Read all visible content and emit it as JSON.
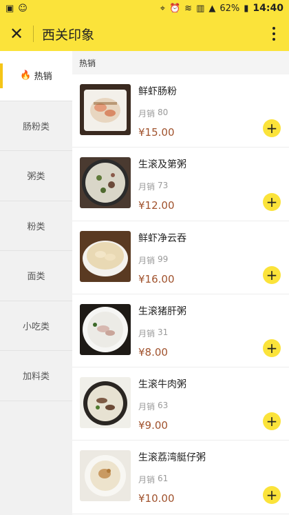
{
  "status_bar": {
    "left_icons": [
      "image-icon",
      "emoji-icon"
    ],
    "right_icons": [
      "location-icon",
      "alarm-icon",
      "wifi-icon",
      "hd-icon",
      "signal-icon"
    ],
    "battery": "62%",
    "time": "14:40"
  },
  "header": {
    "title": "西关印象"
  },
  "sidebar": {
    "items": [
      {
        "label": "热销",
        "active": true
      },
      {
        "label": "肠粉类"
      },
      {
        "label": "粥类"
      },
      {
        "label": "粉类"
      },
      {
        "label": "面类"
      },
      {
        "label": "小吃类"
      },
      {
        "label": "加料类"
      }
    ]
  },
  "section": {
    "title": "热销"
  },
  "items": [
    {
      "name": "鲜虾肠粉",
      "sales_label": "月销",
      "sales": "80",
      "price": "¥15.00",
      "add": "+"
    },
    {
      "name": "生滚及第粥",
      "sales_label": "月销",
      "sales": "73",
      "price": "¥12.00",
      "add": "+"
    },
    {
      "name": "鲜虾净云吞",
      "sales_label": "月销",
      "sales": "99",
      "price": "¥16.00",
      "add": "+"
    },
    {
      "name": "生滚猪肝粥",
      "sales_label": "月销",
      "sales": "31",
      "price": "¥8.00",
      "add": "+"
    },
    {
      "name": "生滚牛肉粥",
      "sales_label": "月销",
      "sales": "63",
      "price": "¥9.00",
      "add": "+"
    },
    {
      "name": "生滚荔湾艇仔粥",
      "sales_label": "月销",
      "sales": "61",
      "price": "¥10.00",
      "add": "+"
    }
  ],
  "colors": {
    "accent": "#fbe33a",
    "price": "#a0522d",
    "active_bar": "#f5c518"
  }
}
